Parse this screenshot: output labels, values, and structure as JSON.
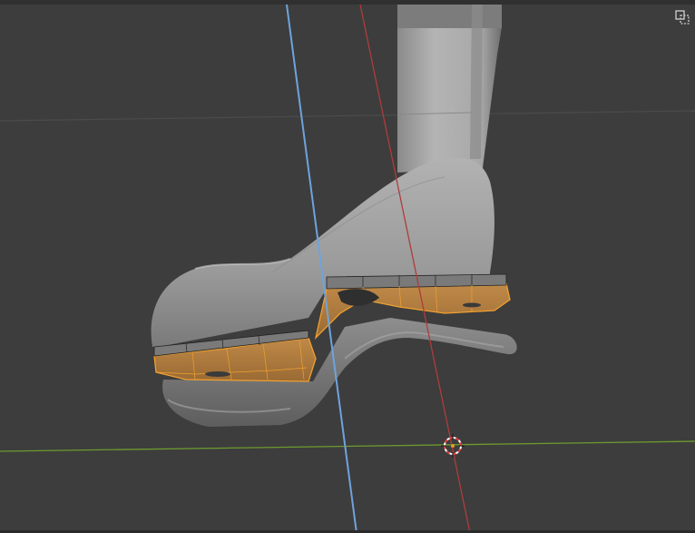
{
  "viewport": {
    "title": "",
    "background": "#3d3d3d",
    "colors": {
      "grid_line": "#4a4a4a",
      "axis_x": "#b03c3c",
      "axis_y": "#6d9a2f",
      "axis_z": "#6fa3de",
      "mesh_fill": "#9e9e9e",
      "mesh_shadow": "#6c6c6c",
      "selected_fill": "#b5803f",
      "selected_edge": "#f0a030",
      "cursor_red": "#e04040",
      "cursor_white": "#ffffff"
    },
    "icons": {
      "top_right": "toggle-xray-icon",
      "cursor": "3d-cursor-icon"
    }
  }
}
